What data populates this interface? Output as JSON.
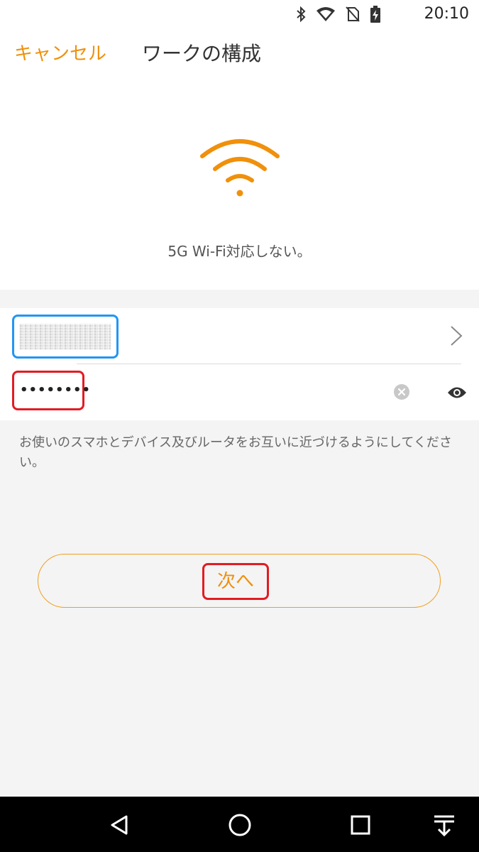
{
  "status_bar": {
    "time": "20:10",
    "icons": [
      "bluetooth-icon",
      "wifi-signal-icon",
      "no-sim-icon",
      "battery-charging-icon"
    ]
  },
  "header": {
    "cancel_label": "キャンセル",
    "title": "ワークの構成"
  },
  "hero": {
    "icon": "wifi-icon",
    "icon_color": "#f0900b",
    "hint": "5G Wi-Fi対応しない。"
  },
  "form": {
    "ssid_value": "",
    "password_value": "••••••••",
    "ssid_box_color": "#2196f3",
    "highlight_color": "#e31b23"
  },
  "advice_text": "お使いのスマホとデバイス及びルータをお互いに近づけるようにしてください。",
  "next_button": {
    "label": "次へ",
    "border_color": "#f0a020",
    "text_color": "#f0900b"
  },
  "nav_bar": {
    "buttons": [
      "back-icon",
      "home-icon",
      "recents-icon",
      "notifications-pull-icon"
    ]
  }
}
